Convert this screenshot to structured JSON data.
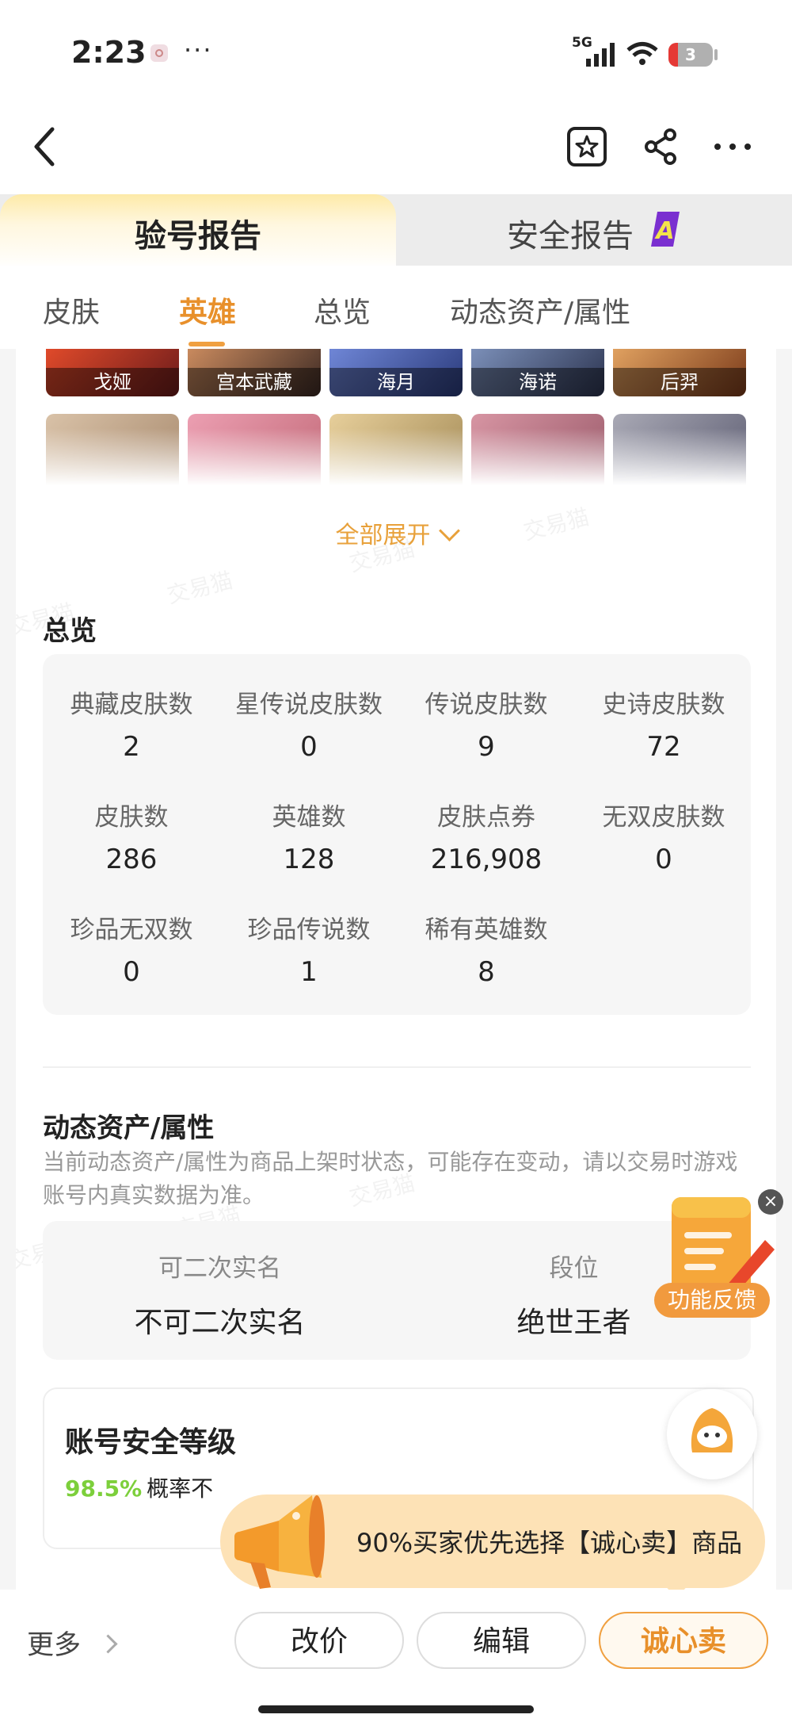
{
  "status_bar": {
    "time": "2:23",
    "dots": "···",
    "network": "5G",
    "battery": "3"
  },
  "nav": {
    "back_icon": "chevron-left-icon",
    "favorite_icon": "star-box-icon",
    "share_icon": "share-icon",
    "more_icon": "more-horizontal-icon"
  },
  "main_tabs": {
    "active": "验号报告",
    "inactive": "安全报告",
    "grade_badge": "A"
  },
  "sub_tabs": [
    "皮肤",
    "英雄",
    "总览",
    "动态资产/属性"
  ],
  "heroes": [
    "戈娅",
    "宫本武藏",
    "海月",
    "海诺",
    "后羿"
  ],
  "expand_label": "全部展开",
  "overview": {
    "title": "总览",
    "stats": [
      {
        "label": "典藏皮肤数",
        "value": "2"
      },
      {
        "label": "星传说皮肤数",
        "value": "0"
      },
      {
        "label": "传说皮肤数",
        "value": "9"
      },
      {
        "label": "史诗皮肤数",
        "value": "72"
      },
      {
        "label": "皮肤数",
        "value": "286"
      },
      {
        "label": "英雄数",
        "value": "128"
      },
      {
        "label": "皮肤点券",
        "value": "216,908"
      },
      {
        "label": "无双皮肤数",
        "value": "0"
      },
      {
        "label": "珍品无双数",
        "value": "0"
      },
      {
        "label": "珍品传说数",
        "value": "1"
      },
      {
        "label": "稀有英雄数",
        "value": "8"
      }
    ]
  },
  "dynamic": {
    "title": "动态资产/属性",
    "desc": "当前动态资产/属性为商品上架时状态，可能存在变动，请以交易时游戏账号内真实数据为准。",
    "attrs": [
      {
        "label": "可二次实名",
        "value": "不可二次实名"
      },
      {
        "label": "段位",
        "value": "绝世王者"
      }
    ]
  },
  "safety": {
    "title": "账号安全等级",
    "rate": "98.5%",
    "rate_text": "概率不"
  },
  "watermark": "交易猫",
  "feedback": {
    "label": "功能反馈",
    "close": "×"
  },
  "promo": {
    "text": "90%买家优先选择【诚心卖】商品"
  },
  "bottom": {
    "more": "更多",
    "buttons": [
      "改价",
      "编辑",
      "诚心卖"
    ]
  },
  "colors": {
    "accent": "#e8902b",
    "promo_bg": "#fde2b6",
    "rate_green": "#7ccf3b"
  }
}
